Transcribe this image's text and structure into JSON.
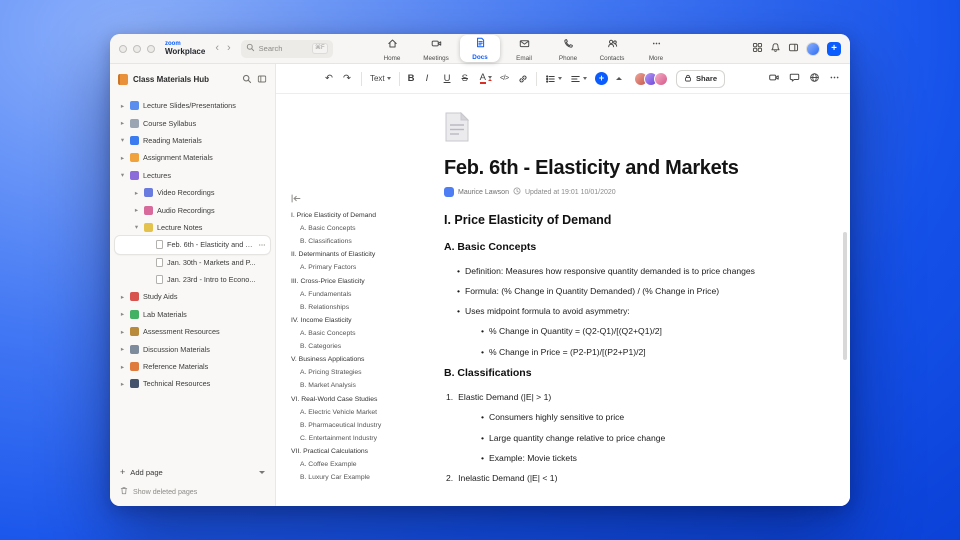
{
  "glyphs": {
    "back": "‹",
    "forward": "›",
    "plus": "+"
  },
  "search": {
    "placeholder": "Search",
    "shortcut": "⌘F"
  },
  "brand": {
    "zoom": "zoom",
    "workplace": "Workplace"
  },
  "nav": {
    "tabs": [
      {
        "label": "Home",
        "icon": "home",
        "active": false
      },
      {
        "label": "Meetings",
        "icon": "meetings",
        "active": false
      },
      {
        "label": "Docs",
        "icon": "docs",
        "active": true
      },
      {
        "label": "Email",
        "icon": "email",
        "active": false
      },
      {
        "label": "Phone",
        "icon": "phone",
        "active": false
      },
      {
        "label": "Contacts",
        "icon": "contacts",
        "active": false
      },
      {
        "label": "More",
        "icon": "more",
        "active": false
      }
    ]
  },
  "sidebar": {
    "title": "Class Materials Hub",
    "items": [
      {
        "label": "Lecture Slides/Presentations",
        "icon": "presentation",
        "color": "#5b8def",
        "level": 1,
        "expanded": false
      },
      {
        "label": "Course Syllabus",
        "icon": "syllabus",
        "color": "#9aa4b2",
        "level": 1,
        "expanded": false
      },
      {
        "label": "Reading Materials",
        "icon": "book",
        "color": "#3b7df0",
        "level": 1,
        "expanded": true
      },
      {
        "label": "Assignment Materials",
        "icon": "assignment",
        "color": "#f0a23c",
        "level": 1,
        "expanded": false
      },
      {
        "label": "Lectures",
        "icon": "lecture",
        "color": "#8b6cd9",
        "level": 1,
        "expanded": true
      },
      {
        "label": "Video Recordings",
        "icon": "video",
        "color": "#6a7be0",
        "level": 2,
        "expanded": false
      },
      {
        "label": "Audio Recordings",
        "icon": "audio",
        "color": "#d76a9a",
        "level": 2,
        "expanded": false
      },
      {
        "label": "Lecture Notes",
        "icon": "notes",
        "color": "#e4c24e",
        "level": 2,
        "expanded": true
      },
      {
        "label": "Feb. 6th - Elasticity and M...",
        "icon": "page",
        "color": "#ffffff",
        "level": 3,
        "selected": true
      },
      {
        "label": "Jan. 30th - Markets and P...",
        "icon": "page",
        "color": "#ffffff",
        "level": 3
      },
      {
        "label": "Jan. 23rd - Intro to Econo...",
        "icon": "page",
        "color": "#ffffff",
        "level": 3
      },
      {
        "label": "Study Aids",
        "icon": "study",
        "color": "#d8534e",
        "level": 1
      },
      {
        "label": "Lab Materials",
        "icon": "lab",
        "color": "#43b163",
        "level": 1
      },
      {
        "label": "Assessment Resources",
        "icon": "assessment",
        "color": "#b78a3c",
        "level": 1
      },
      {
        "label": "Discussion Materials",
        "icon": "discussion",
        "color": "#7d8b9d",
        "level": 1
      },
      {
        "label": "Reference Materials",
        "icon": "reference",
        "color": "#e07b3e",
        "level": 1
      },
      {
        "label": "Technical Resources",
        "icon": "technical",
        "color": "#44536b",
        "level": 1
      }
    ],
    "add_page": "Add page",
    "show_deleted": "Show deleted pages"
  },
  "toolbar": {
    "undo": "↶",
    "redo": "↷",
    "text_style": "Text",
    "bold": "B",
    "italic": "I",
    "underline": "U",
    "strikethrough": "S",
    "text_color": "A",
    "code": "</>",
    "share": "Share"
  },
  "outline": {
    "items": [
      {
        "label": "I. Price Elasticity of Demand",
        "level": 1
      },
      {
        "label": "A. Basic Concepts",
        "level": 2
      },
      {
        "label": "B. Classifications",
        "level": 2
      },
      {
        "label": "II. Determinants of Elasticity",
        "level": 1
      },
      {
        "label": "A. Primary Factors",
        "level": 2
      },
      {
        "label": "III. Cross-Price Elasticity",
        "level": 1
      },
      {
        "label": "A. Fundamentals",
        "level": 2
      },
      {
        "label": "B. Relationships",
        "level": 2
      },
      {
        "label": "IV. Income Elasticity",
        "level": 1
      },
      {
        "label": "A. Basic Concepts",
        "level": 2
      },
      {
        "label": "B. Categories",
        "level": 2
      },
      {
        "label": "V. Business Applications",
        "level": 1
      },
      {
        "label": "A. Pricing Strategies",
        "level": 2
      },
      {
        "label": "B. Market Analysis",
        "level": 2
      },
      {
        "label": "VI. Real-World Case Studies",
        "level": 1
      },
      {
        "label": "A. Electric Vehicle Market",
        "level": 2
      },
      {
        "label": "B. Pharmaceutical Industry",
        "level": 2
      },
      {
        "label": "C. Entertainment Industry",
        "level": 2
      },
      {
        "label": "VII. Practical Calculations",
        "level": 1
      },
      {
        "label": "A. Coffee Example",
        "level": 2
      },
      {
        "label": "B. Luxury Car Example",
        "level": 2
      }
    ]
  },
  "doc": {
    "title": "Feb. 6th - Elasticity and Markets",
    "author": "Maurice Lawson",
    "updated": "Updated at 19:01 10/01/2020",
    "blocks": [
      {
        "type": "h2",
        "text": "I. Price Elasticity of Demand"
      },
      {
        "type": "h3",
        "text": "A. Basic Concepts"
      },
      {
        "type": "bullet",
        "level": 1,
        "marker": "•",
        "text": "Definition: Measures how responsive quantity demanded is to price changes"
      },
      {
        "type": "bullet",
        "level": 1,
        "marker": "•",
        "text": "Formula: (% Change in Quantity Demanded) / (% Change in Price)"
      },
      {
        "type": "bullet",
        "level": 1,
        "marker": "•",
        "text": "Uses midpoint formula to avoid asymmetry:"
      },
      {
        "type": "bullet",
        "level": 2,
        "marker": "•",
        "text": "% Change in Quantity = (Q2-Q1)/[(Q2+Q1)/2]"
      },
      {
        "type": "bullet",
        "level": 2,
        "marker": "•",
        "text": "% Change in Price = (P2-P1)/[(P2+P1)/2]"
      },
      {
        "type": "h3",
        "text": "B. Classifications"
      },
      {
        "type": "number",
        "marker": "1.",
        "text": "Elastic Demand (|E| > 1)"
      },
      {
        "type": "bullet",
        "level": 2,
        "marker": "•",
        "text": "Consumers highly sensitive to price"
      },
      {
        "type": "bullet",
        "level": 2,
        "marker": "•",
        "text": "Large quantity change relative to price change"
      },
      {
        "type": "bullet",
        "level": 2,
        "marker": "•",
        "text": "Example: Movie tickets"
      },
      {
        "type": "number",
        "marker": "2.",
        "text": "Inelastic Demand (|E| < 1)"
      }
    ]
  }
}
